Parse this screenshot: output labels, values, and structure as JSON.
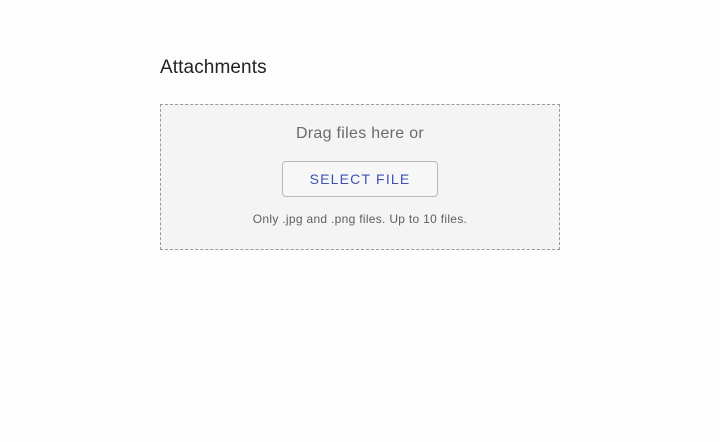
{
  "attachments": {
    "title": "Attachments",
    "drop_text": "Drag files here or",
    "select_button_label": "SELECT FILE",
    "hint": "Only .jpg and .png files. Up to 10 files."
  },
  "colors": {
    "accent": "#3f51b5",
    "dropzone_background": "#f4f4f4",
    "dropzone_border": "#9a9a9a"
  }
}
